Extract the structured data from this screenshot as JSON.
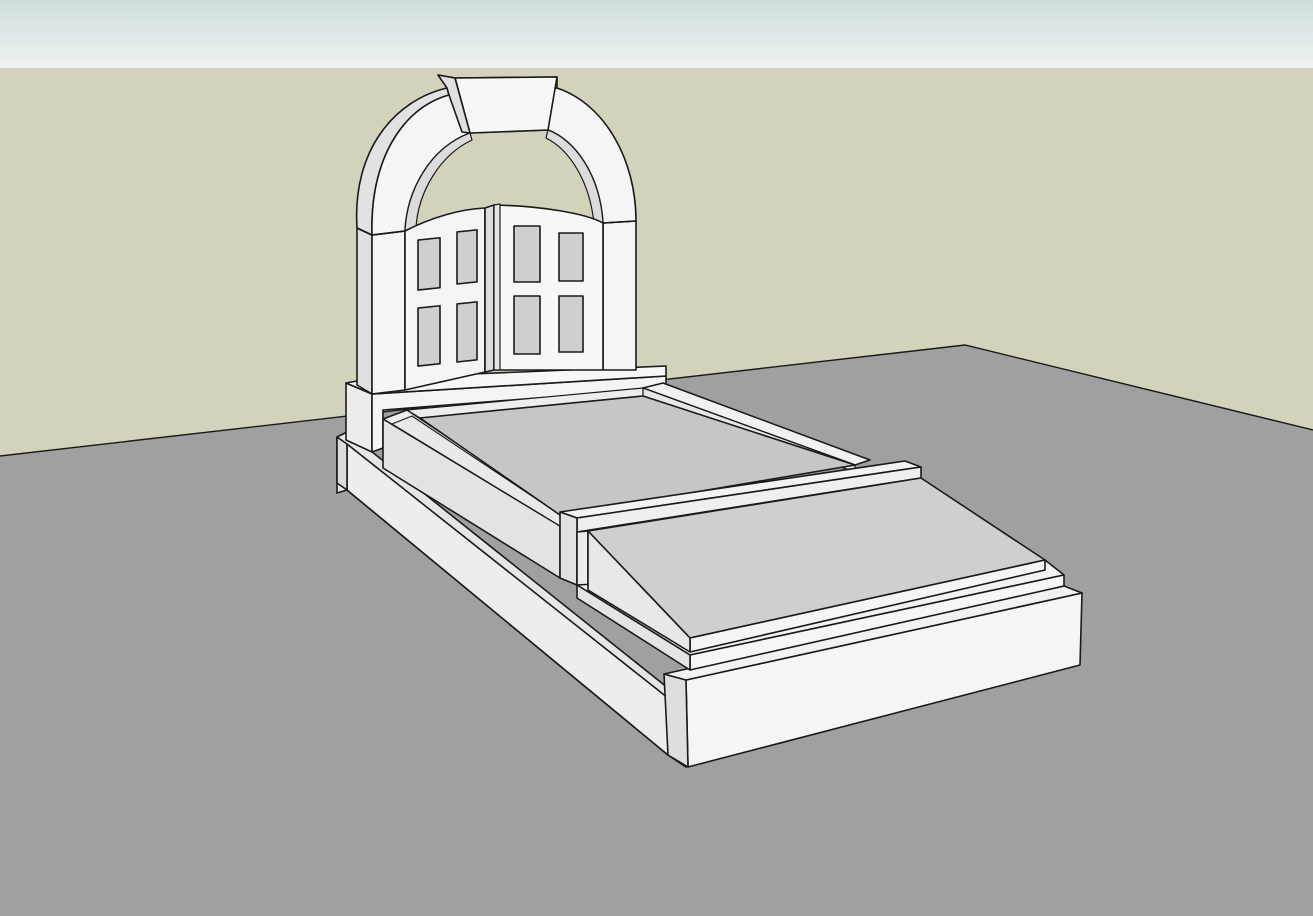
{
  "scene": {
    "type": "3d-model-viewport",
    "subject": "tombstone-with-arch-and-double-door-headstone",
    "colors": {
      "sky": "#dde6e6",
      "wall": "#d3d2bb",
      "ground": "#a0a0a0",
      "lit_face": "#f4f4f4",
      "side_face": "#e2e2e2",
      "shadow_face": "#cfcfcf",
      "top_slab": "#cfcfcf",
      "inner_tray": "#c6c6c6",
      "edge": "#1a1a1a"
    }
  }
}
